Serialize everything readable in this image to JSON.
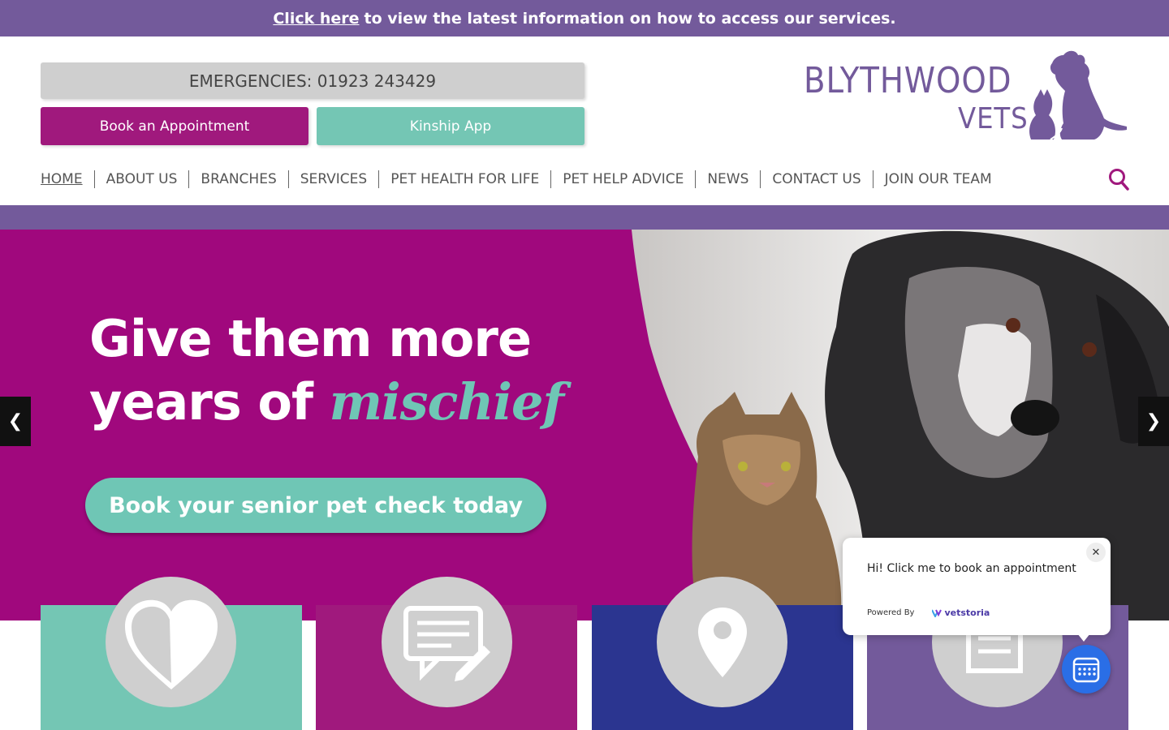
{
  "notice": {
    "link": "Click here",
    "text": "to view the latest information on how to access our services."
  },
  "header": {
    "emergency": "EMERGENCIES: 01923 243429",
    "book_button": "Book an Appointment",
    "kinship_button": "Kinship App",
    "logo_line1": "BLYTHWOOD",
    "logo_line2": "VETS"
  },
  "nav": {
    "items": [
      "HOME",
      "ABOUT US",
      "BRANCHES",
      "SERVICES",
      "PET HEALTH FOR LIFE",
      "PET HELP ADVICE",
      "NEWS",
      "CONTACT US",
      "JOIN OUR TEAM"
    ]
  },
  "hero": {
    "line1": "Give them more",
    "line2_prefix": "years of ",
    "line2_accent": "mischief",
    "cta": "Book your senior pet check today",
    "prev_arrow": "❮",
    "next_arrow": "❯"
  },
  "tiles": [
    {
      "icon": "heart-icon",
      "color": "#74c6b4"
    },
    {
      "icon": "message-edit-icon",
      "color": "#a0197d"
    },
    {
      "icon": "map-pin-icon",
      "color": "#2b3590"
    },
    {
      "icon": "form-icon",
      "color": "#735a9b"
    }
  ],
  "chat": {
    "message": "Hi! Click me to book an appointment",
    "powered_by": "Powered By",
    "brand": "vetstoria",
    "close": "✕"
  },
  "colors": {
    "purple": "#735a9b",
    "magenta": "#a0197d",
    "teal": "#74c6b4",
    "navy": "#2b3590",
    "chat_blue": "#2a6ee6"
  }
}
